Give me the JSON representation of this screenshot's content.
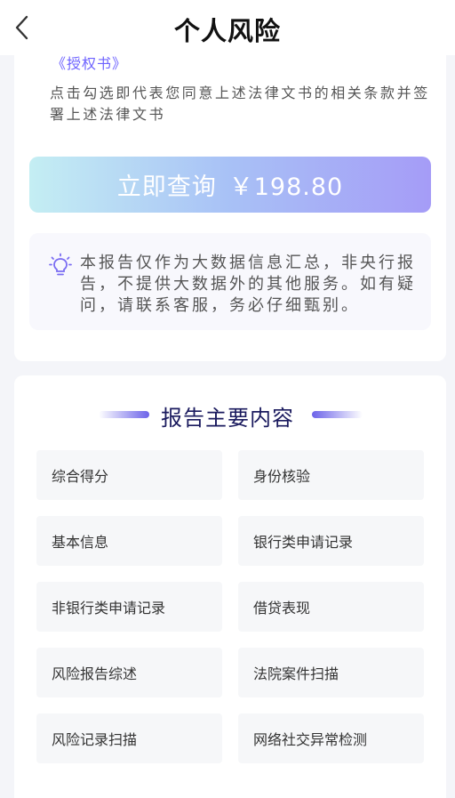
{
  "header": {
    "title": "个人风险",
    "back_icon": "chevron-left-icon"
  },
  "agreement": {
    "link_text": "《授权书》",
    "text": "点击勾选即代表您同意上述法律文书的相关条款并签署上述法律文书"
  },
  "query_button": {
    "label": "立即查询",
    "price": "￥198.80"
  },
  "notice": {
    "icon": "lightbulb-icon",
    "text": "本报告仅作为大数据信息汇总，非央行报告，不提供大数据外的其他服务。如有疑问，请联系客服，务必仔细甄别。"
  },
  "report_section": {
    "title": "报告主要内容",
    "items": [
      {
        "label": "综合得分"
      },
      {
        "label": "身份核验"
      },
      {
        "label": "基本信息"
      },
      {
        "label": "银行类申请记录"
      },
      {
        "label": "非银行类申请记录"
      },
      {
        "label": "借贷表现"
      },
      {
        "label": "风险报告综述"
      },
      {
        "label": "法院案件扫描"
      },
      {
        "label": "风险记录扫描"
      },
      {
        "label": "网络社交异常检测"
      }
    ]
  },
  "colors": {
    "accent": "#6e63ff",
    "button_gradient_start": "#c4eef3",
    "button_gradient_end": "#a59cf7",
    "section_title": "#1a1a5e"
  }
}
